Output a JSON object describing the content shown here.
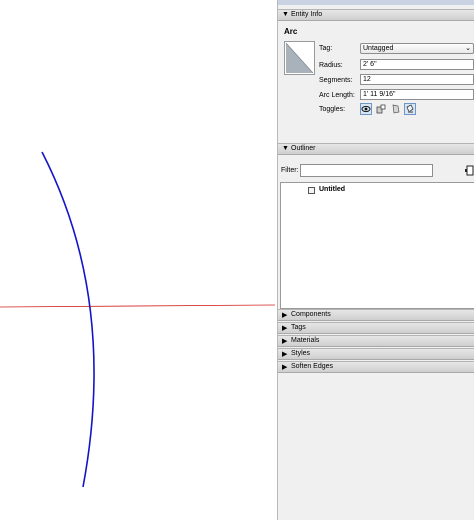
{
  "viewport": {
    "axis_color": "#d22020",
    "arc_color": "#1414c8"
  },
  "entity_info": {
    "header": "Entity Info",
    "entity_type": "Arc",
    "tag_label": "Tag:",
    "tag_value": "Untagged",
    "radius_label": "Radius:",
    "radius_value": "2' 6\"",
    "segments_label": "Segments:",
    "segments_value": "12",
    "arc_length_label": "Arc Length:",
    "arc_length_value": "1' 11 9/16\"",
    "toggles_label": "Toggles:",
    "toggles": [
      "visible-eye-icon",
      "receive-shadows-icon",
      "cast-shadows-icon",
      "ground-shadow-icon"
    ]
  },
  "outliner": {
    "header": "Outliner",
    "filter_label": "Filter:",
    "filter_value": "",
    "root_item": "Untitled"
  },
  "collapsed_panels": [
    "Components",
    "Tags",
    "Materials",
    "Styles",
    "Soften Edges"
  ]
}
